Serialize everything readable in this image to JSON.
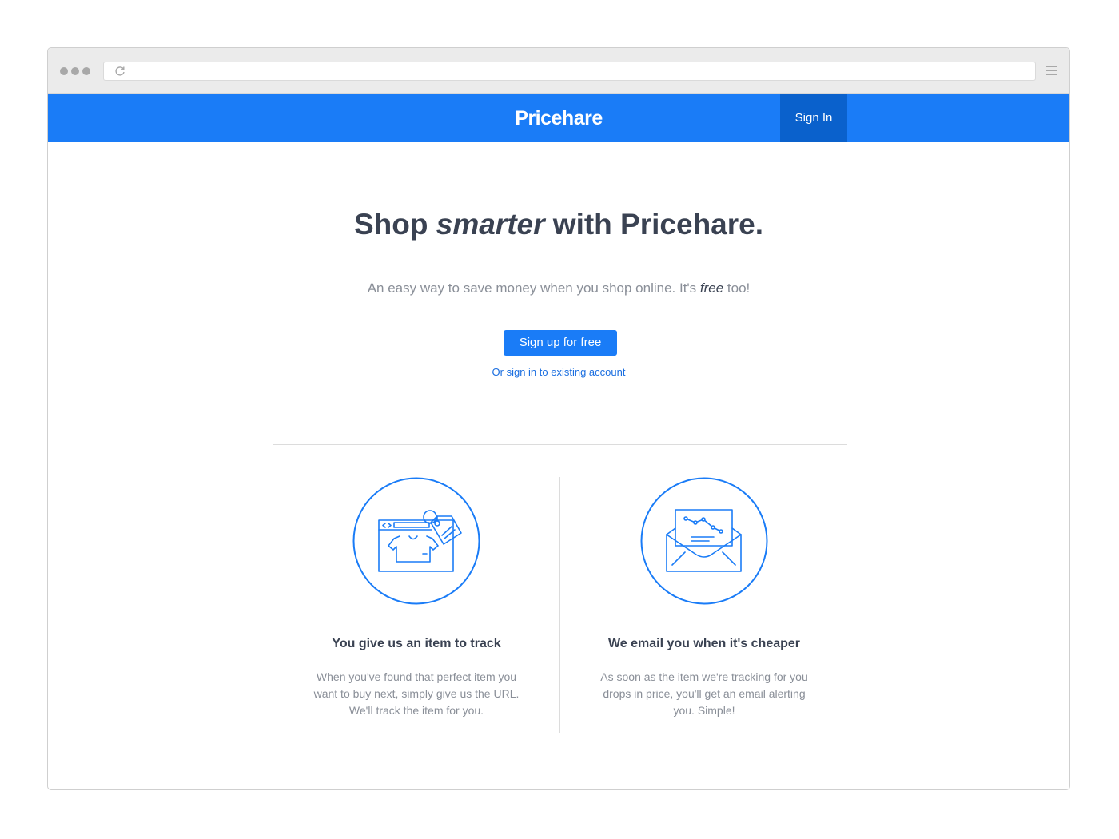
{
  "brand": {
    "name": "Pricehare",
    "accent": "#1a7cf7",
    "accent_dark": "#0a61cc"
  },
  "nav": {
    "sign_in_label": "Sign In"
  },
  "hero": {
    "title_prefix": "Shop ",
    "title_emphasis": "smarter",
    "title_suffix": " with Pricehare.",
    "subtitle_prefix": "An easy way to save money when you shop online. It's ",
    "subtitle_emphasis": "free",
    "subtitle_suffix": " too!",
    "signup_label": "Sign up for free",
    "signin_link_label": "Or sign in to existing account"
  },
  "features": [
    {
      "icon": "browser-price-tag-icon",
      "title": "You give us an item to track",
      "text": "When you've found that perfect item you want to buy next, simply give us the URL. We'll track the item for you."
    },
    {
      "icon": "envelope-price-chart-icon",
      "title": "We email you when it's cheaper",
      "text": "As soon as the item we're tracking for you drops in price, you'll get an email alerting you. Simple!"
    }
  ]
}
